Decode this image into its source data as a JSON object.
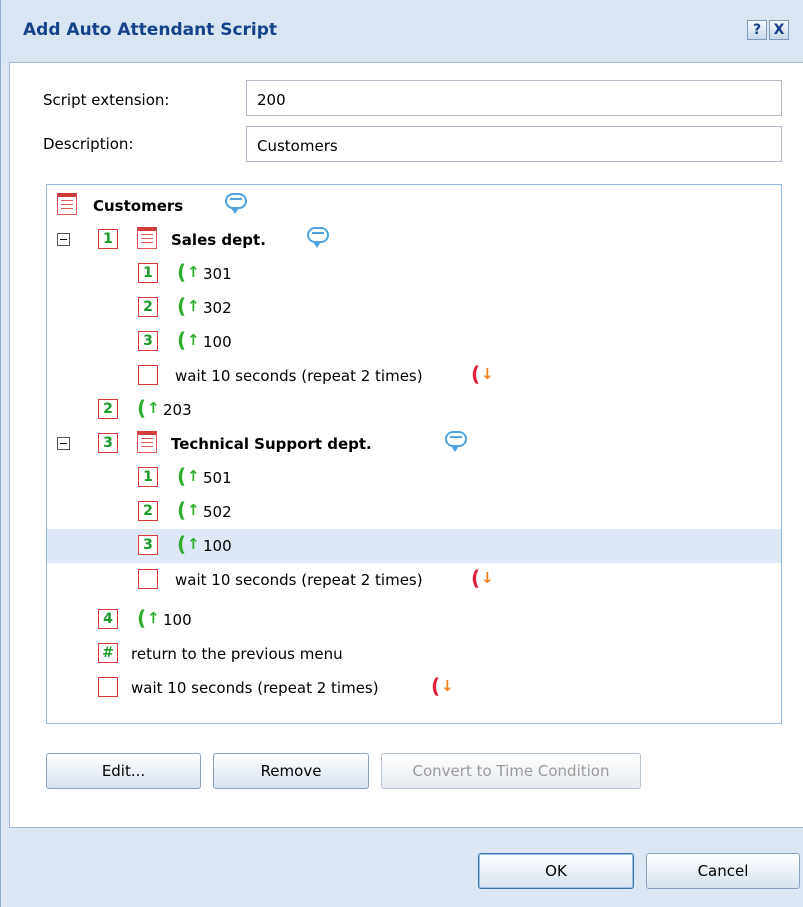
{
  "dialog": {
    "title": "Add Auto Attendant Script",
    "help_label": "?",
    "close_label": "X"
  },
  "form": {
    "extension_label": "Script extension:",
    "extension_value": "200",
    "description_label": "Description:",
    "description_value": "Customers"
  },
  "tree": {
    "root_label": "Customers",
    "sales": {
      "key": "1",
      "label": "Sales dept.",
      "items": [
        {
          "key": "1",
          "label": "301"
        },
        {
          "key": "2",
          "label": "302"
        },
        {
          "key": "3",
          "label": "100"
        }
      ],
      "wait_label": "wait 10 seconds (repeat 2 times)"
    },
    "item2": {
      "key": "2",
      "label": "203"
    },
    "support": {
      "key": "3",
      "label": "Technical Support dept.",
      "items": [
        {
          "key": "1",
          "label": "501"
        },
        {
          "key": "2",
          "label": "502"
        },
        {
          "key": "3",
          "label": "100",
          "selected": true
        }
      ],
      "wait_label": "wait 10 seconds (repeat 2 times)"
    },
    "item4": {
      "key": "4",
      "label": "100"
    },
    "return_item": {
      "key": "#",
      "label": "return to the previous menu"
    },
    "root_wait_label": "wait 10 seconds (repeat 2 times)"
  },
  "buttons": {
    "edit": "Edit...",
    "remove": "Remove",
    "convert": "Convert to Time Condition",
    "ok": "OK",
    "cancel": "Cancel"
  },
  "colors": {
    "title": "#15428b",
    "tree_border": "#99bbe8",
    "selected_row": "#dfe8f6",
    "key_border": "#e03a3a",
    "key_text": "#1a9a2a",
    "phone_out": "#2eae2e",
    "phone_back": "#e0203a"
  },
  "icons": [
    "help-icon",
    "close-icon",
    "menu-icon",
    "comment-icon",
    "collapse-icon",
    "phone-forward-icon",
    "phone-return-icon"
  ]
}
